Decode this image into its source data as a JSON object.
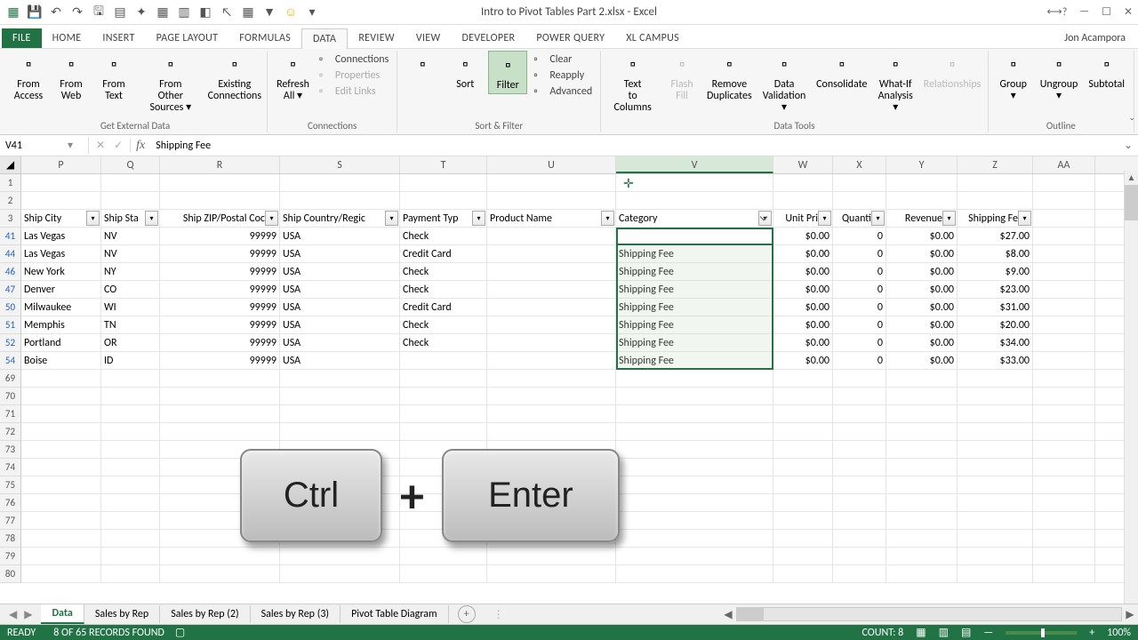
{
  "title": "Intro to Pivot Tables Part 2.xlsx - Excel",
  "user": "Jon Acampora",
  "tabs": [
    "FILE",
    "HOME",
    "INSERT",
    "PAGE LAYOUT",
    "FORMULAS",
    "DATA",
    "REVIEW",
    "VIEW",
    "DEVELOPER",
    "POWER QUERY",
    "XL Campus"
  ],
  "activeTab": 5,
  "ribbon": {
    "groups": [
      {
        "label": "Get External Data",
        "big": [
          {
            "name": "from-access",
            "label": "From Access"
          },
          {
            "name": "from-web",
            "label": "From Web"
          },
          {
            "name": "from-text",
            "label": "From Text"
          },
          {
            "name": "from-other",
            "label": "From Other Sources ▾"
          },
          {
            "name": "existing-conn",
            "label": "Existing Connections"
          }
        ]
      },
      {
        "label": "Connections",
        "big": [
          {
            "name": "refresh-all",
            "label": "Refresh All ▾"
          }
        ],
        "small": [
          {
            "name": "connections",
            "label": "Connections",
            "dis": false
          },
          {
            "name": "properties",
            "label": "Properties",
            "dis": true
          },
          {
            "name": "edit-links",
            "label": "Edit Links",
            "dis": true
          }
        ]
      },
      {
        "label": "Sort & Filter",
        "big": [
          {
            "name": "sort-az",
            "label": ""
          },
          {
            "name": "sort",
            "label": "Sort"
          },
          {
            "name": "filter",
            "label": "Filter",
            "active": true
          }
        ],
        "small": [
          {
            "name": "clear",
            "label": "Clear"
          },
          {
            "name": "reapply",
            "label": "Reapply"
          },
          {
            "name": "advanced",
            "label": "Advanced"
          }
        ]
      },
      {
        "label": "Data Tools",
        "big": [
          {
            "name": "text-to-cols",
            "label": "Text to Columns"
          },
          {
            "name": "flash-fill",
            "label": "Flash Fill",
            "dis": true
          },
          {
            "name": "remove-dups",
            "label": "Remove Duplicates"
          },
          {
            "name": "data-validation",
            "label": "Data Validation ▾"
          },
          {
            "name": "consolidate",
            "label": "Consolidate"
          },
          {
            "name": "what-if",
            "label": "What-If Analysis ▾"
          },
          {
            "name": "relationships",
            "label": "Relationships",
            "dis": true
          }
        ]
      },
      {
        "label": "Outline",
        "big": [
          {
            "name": "group",
            "label": "Group ▾"
          },
          {
            "name": "ungroup",
            "label": "Ungroup ▾"
          },
          {
            "name": "subtotal",
            "label": "Subtotal"
          }
        ]
      }
    ]
  },
  "namebox": "V41",
  "formula": "Shipping Fee",
  "columns": [
    {
      "letter": "P",
      "w": 90,
      "header": "Ship City"
    },
    {
      "letter": "Q",
      "w": 66,
      "header": "Ship Sta"
    },
    {
      "letter": "R",
      "w": 135,
      "header": "Ship ZIP/Postal Coc"
    },
    {
      "letter": "S",
      "w": 135,
      "header": "Ship Country/Regic"
    },
    {
      "letter": "T",
      "w": 98,
      "header": "Payment Typ"
    },
    {
      "letter": "U",
      "w": 145,
      "header": "Product Name"
    },
    {
      "letter": "V",
      "w": 177,
      "header": "Category",
      "sel": true,
      "filtered": true
    },
    {
      "letter": "W",
      "w": 67,
      "header": "Unit Pri"
    },
    {
      "letter": "X",
      "w": 60,
      "header": "Quanti"
    },
    {
      "letter": "Y",
      "w": 80,
      "header": "Revenue"
    },
    {
      "letter": "Z",
      "w": 85,
      "header": "Shipping Fe"
    },
    {
      "letter": "AA",
      "w": 70,
      "header": ""
    }
  ],
  "headerRow": 3,
  "blankRows": [
    1,
    2
  ],
  "dataRows": [
    {
      "n": 41,
      "c": [
        "Las Vegas",
        "NV",
        "99999",
        "USA",
        "Check",
        "",
        "Shipping Fee",
        "$0.00",
        "0",
        "$0.00",
        "$27.00",
        ""
      ]
    },
    {
      "n": 44,
      "c": [
        "Las Vegas",
        "NV",
        "99999",
        "USA",
        "Credit Card",
        "",
        "Shipping Fee",
        "$0.00",
        "0",
        "$0.00",
        "$8.00",
        ""
      ]
    },
    {
      "n": 46,
      "c": [
        "New York",
        "NY",
        "99999",
        "USA",
        "Check",
        "",
        "Shipping Fee",
        "$0.00",
        "0",
        "$0.00",
        "$9.00",
        ""
      ]
    },
    {
      "n": 47,
      "c": [
        "Denver",
        "CO",
        "99999",
        "USA",
        "Check",
        "",
        "Shipping Fee",
        "$0.00",
        "0",
        "$0.00",
        "$23.00",
        ""
      ]
    },
    {
      "n": 50,
      "c": [
        "Milwaukee",
        "WI",
        "99999",
        "USA",
        "Credit Card",
        "",
        "Shipping Fee",
        "$0.00",
        "0",
        "$0.00",
        "$31.00",
        ""
      ]
    },
    {
      "n": 51,
      "c": [
        "Memphis",
        "TN",
        "99999",
        "USA",
        "Check",
        "",
        "Shipping Fee",
        "$0.00",
        "0",
        "$0.00",
        "$20.00",
        ""
      ]
    },
    {
      "n": 52,
      "c": [
        "Portland",
        "OR",
        "99999",
        "USA",
        "Check",
        "",
        "Shipping Fee",
        "$0.00",
        "0",
        "$0.00",
        "$34.00",
        ""
      ]
    },
    {
      "n": 54,
      "c": [
        "Boise",
        "ID",
        "99999",
        "USA",
        "",
        "",
        "Shipping Fee",
        "$0.00",
        "0",
        "$0.00",
        "$33.00",
        ""
      ]
    }
  ],
  "emptyRows": [
    69,
    70,
    71,
    72,
    73,
    74,
    75,
    76,
    77,
    78,
    79,
    80
  ],
  "sheets": [
    "Data",
    "Sales by Rep",
    "Sales by Rep (2)",
    "Sales by Rep (3)",
    "Pivot Table Diagram"
  ],
  "activeSheet": 0,
  "status": {
    "ready": "READY",
    "records": "8 OF 65 RECORDS FOUND",
    "count": "COUNT: 8",
    "zoom": "100%"
  },
  "overlay": {
    "key1": "Ctrl",
    "plus": "+",
    "key2": "Enter"
  }
}
